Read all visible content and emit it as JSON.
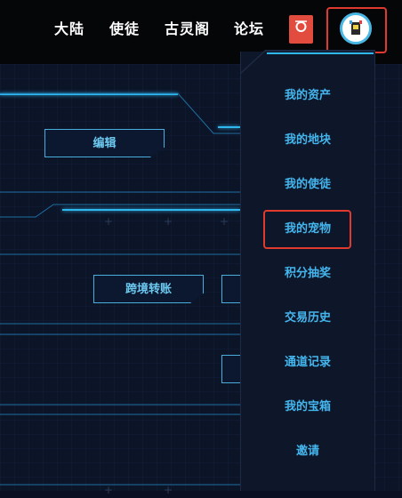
{
  "nav": {
    "items": [
      {
        "label": "大陆"
      },
      {
        "label": "使徒"
      },
      {
        "label": "古灵阁"
      },
      {
        "label": "论坛"
      }
    ]
  },
  "buttons": {
    "edit": "编辑",
    "transfer": "跨境转账"
  },
  "dropdown": {
    "items": [
      {
        "label": "我的资产"
      },
      {
        "label": "我的地块"
      },
      {
        "label": "我的使徒"
      },
      {
        "label": "我的宠物"
      },
      {
        "label": "积分抽奖"
      },
      {
        "label": "交易历史"
      },
      {
        "label": "通道记录"
      },
      {
        "label": "我的宝箱"
      },
      {
        "label": "邀请"
      }
    ]
  },
  "colors": {
    "accent": "#44b6ee",
    "highlight": "#e03a2e",
    "topbar": "#040608",
    "background": "#0c1428"
  },
  "icons": {
    "red_icon": "gift-card-icon",
    "avatar": "user-avatar-icon"
  }
}
